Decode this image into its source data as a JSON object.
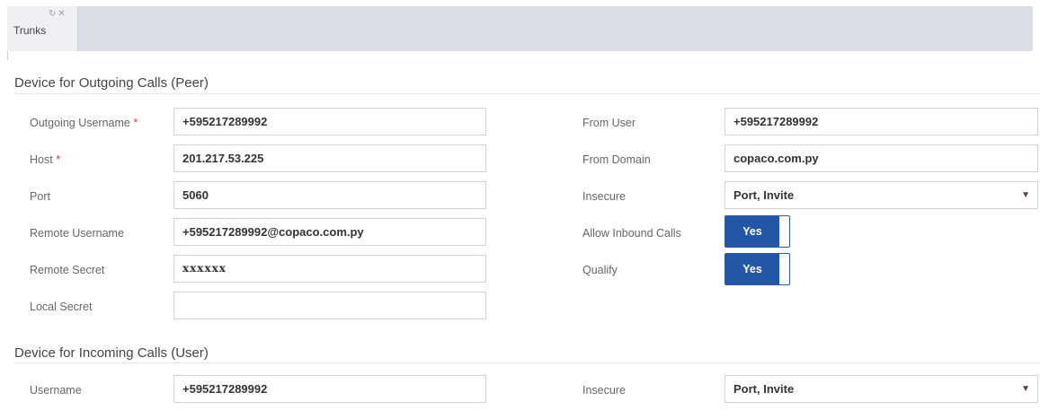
{
  "tab": {
    "label": "Trunks",
    "refresh_icon": "refresh-icon",
    "close_icon": "close-icon"
  },
  "outgoing": {
    "title": "Device for Outgoing Calls (Peer)",
    "outgoing_username": {
      "label": "Outgoing Username",
      "required": "*",
      "value": "+595217289992"
    },
    "host": {
      "label": "Host",
      "required": "*",
      "value": "201.217.53.225"
    },
    "port": {
      "label": "Port",
      "value": "5060"
    },
    "remote_username": {
      "label": "Remote Username",
      "value": "+595217289992@copaco.com.py"
    },
    "remote_secret": {
      "label": "Remote Secret",
      "value": "xxxxxx"
    },
    "local_secret": {
      "label": "Local Secret",
      "value": ""
    },
    "from_user": {
      "label": "From User",
      "value": "+595217289992"
    },
    "from_domain": {
      "label": "From Domain",
      "value": "copaco.com.py"
    },
    "insecure": {
      "label": "Insecure",
      "value": "Port, Invite"
    },
    "allow_inbound": {
      "label": "Allow Inbound Calls",
      "value": "Yes"
    },
    "qualify": {
      "label": "Qualify",
      "value": "Yes"
    }
  },
  "incoming": {
    "title": "Device for Incoming Calls (User)",
    "username": {
      "label": "Username",
      "value": "+595217289992"
    },
    "insecure": {
      "label": "Insecure",
      "value": "Port, Invite"
    }
  }
}
